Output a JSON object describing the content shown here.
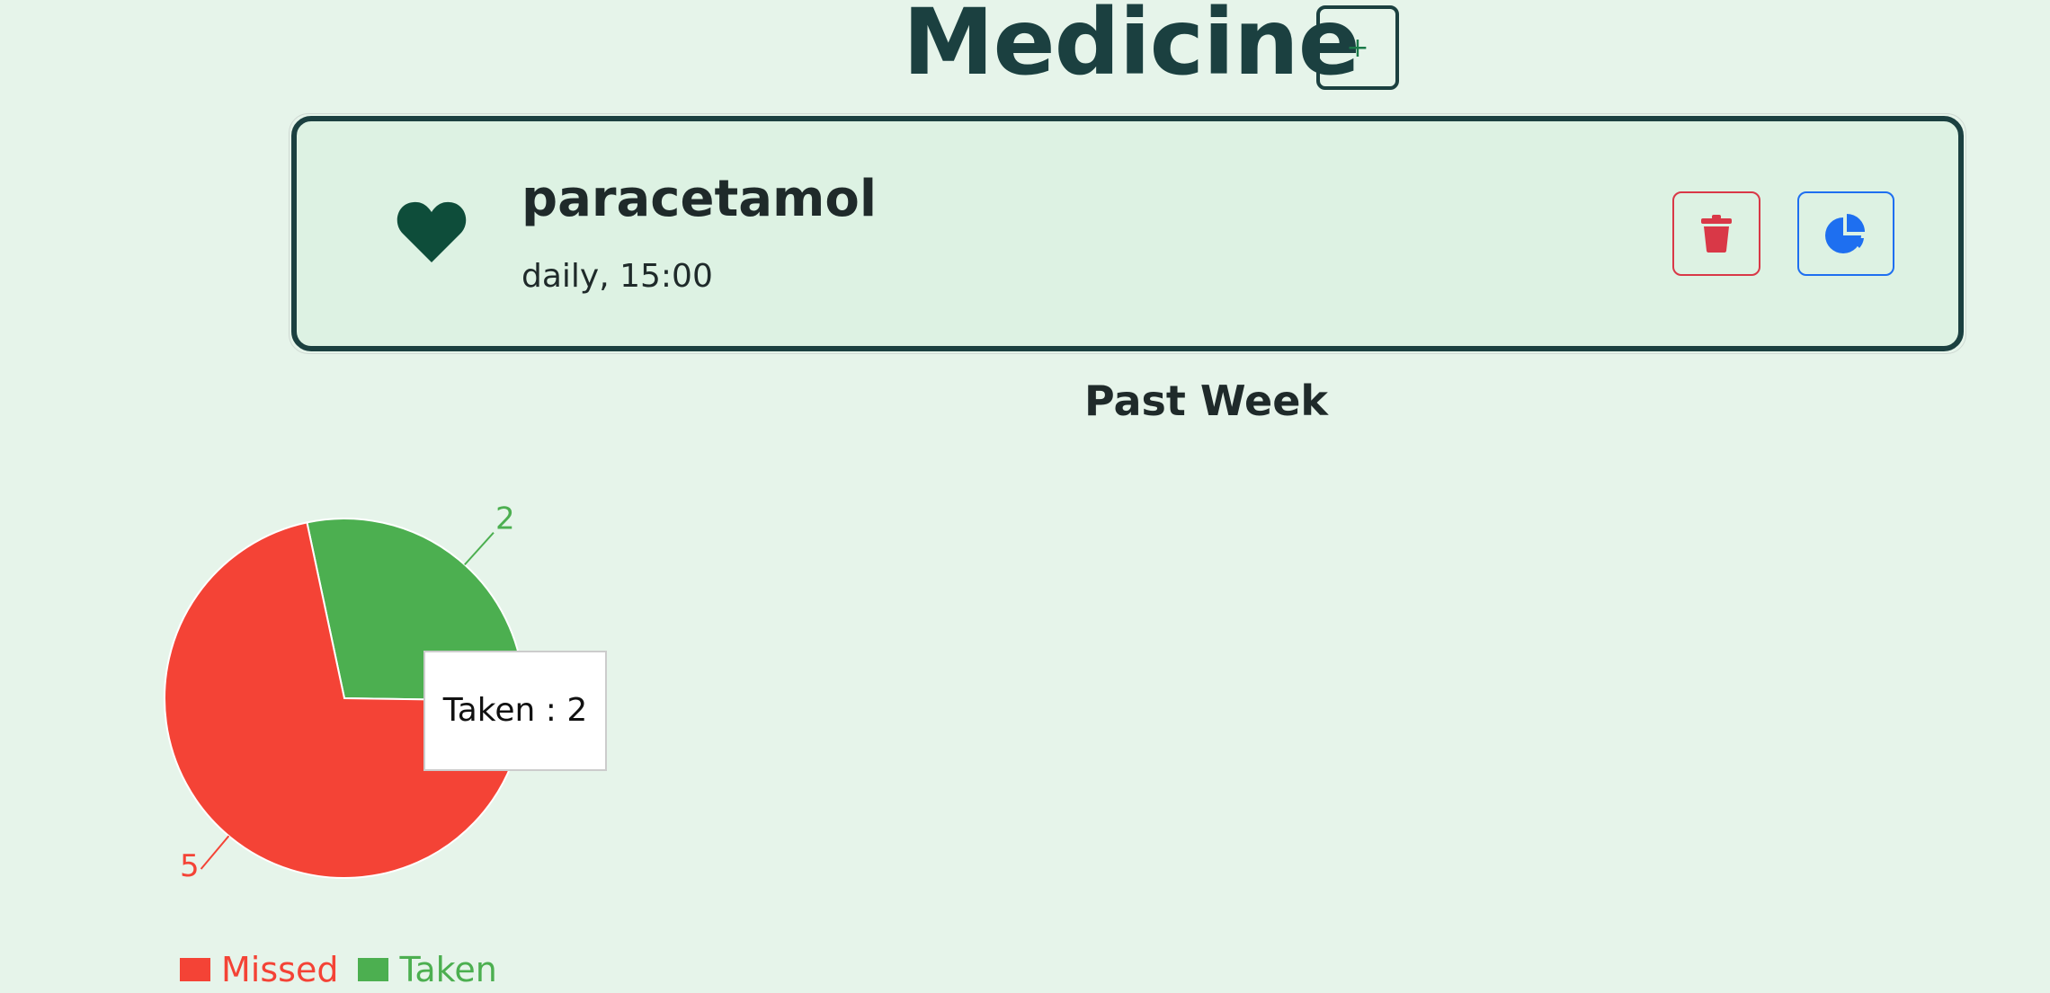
{
  "header": {
    "title": "Medicine",
    "add_label": "+"
  },
  "medicine_card": {
    "icon": "heart-icon",
    "name": "paracetamol",
    "schedule": "daily, 15:00",
    "delete_icon": "trash-icon",
    "stats_icon": "pie-chart-icon"
  },
  "colors": {
    "primary_dark": "#1b4040",
    "card_bg": "#ddf2e3",
    "page_bg": "#e6f4ea",
    "danger": "#d93847",
    "info": "#1e6ff0",
    "missed": "#f44336",
    "taken": "#4caf50"
  },
  "chart_data": {
    "type": "pie",
    "title": "Past Week",
    "slices": [
      {
        "name": "Missed",
        "value": 5,
        "color": "#f44336"
      },
      {
        "name": "Taken",
        "value": 2,
        "color": "#4caf50"
      }
    ],
    "legend_placement": "bottom-left",
    "tooltip": "Taken : 2"
  }
}
